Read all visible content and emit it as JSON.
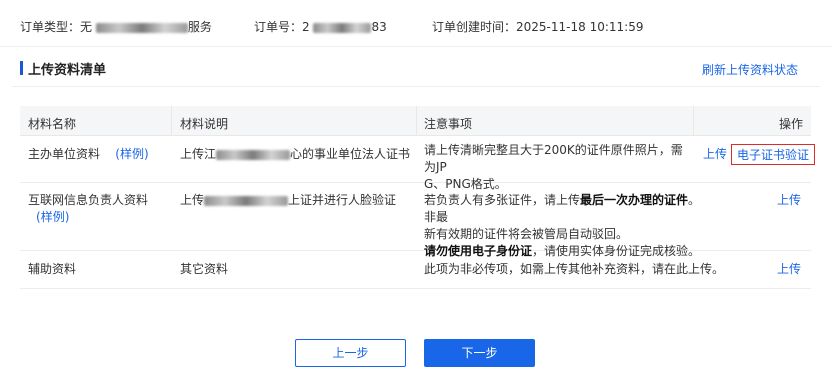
{
  "info": {
    "order_type_label": "订单类型：",
    "order_type_prefix": "无",
    "order_type_suffix": "服务",
    "order_no_label": "订单号：",
    "order_no_prefix": "2",
    "order_no_suffix": "83",
    "created_label": "订单创建时间：",
    "created_value": "2025-11-18 10:11:59"
  },
  "section": {
    "title": "上传资料清单",
    "refresh_label": "刷新上传资料状态"
  },
  "table": {
    "headers": {
      "name": "材料名称",
      "desc": "材料说明",
      "notes": "注意事项",
      "action": "操作"
    },
    "rows": [
      {
        "name": "主办单位资料",
        "example_label": "(",
        "example_link": "样例",
        "example_close": ")",
        "desc_prefix": "上传江",
        "desc_suffix": "心的事业单位法人证书",
        "notes_line1": "请上传清晰完整且大于200K的证件原件照片，需为JP",
        "notes_line2": "G、PNG格式。",
        "upload": "上传",
        "verify": "电子证书验证"
      },
      {
        "name": "互联网信息负责人资料",
        "example_label": "(",
        "example_link": "样例",
        "example_close": ")",
        "desc_prefix": "上传",
        "desc_suffix": "上证并进行人脸验证",
        "notes_a": "若负责人有多张证件，请上传",
        "notes_b": "最后一次办理的证件",
        "notes_c": "。非最",
        "notes_line2": "新有效期的证件将会被管局自动驳回。",
        "notes_bold2": "请勿使用电子身份证",
        "notes_tail2": "，请使用实体身份证完成核验。",
        "upload": "上传"
      },
      {
        "name": "辅助资料",
        "desc": "其它资料",
        "notes": "此项为非必传项，如需上传其他补充资料，请在此上传。",
        "upload": "上传"
      }
    ]
  },
  "buttons": {
    "prev": "上一步",
    "next": "下一步"
  },
  "colors": {
    "primary": "#1a66e8",
    "highlight_border": "#e02b2b",
    "header_bg": "#f5f6f7"
  }
}
